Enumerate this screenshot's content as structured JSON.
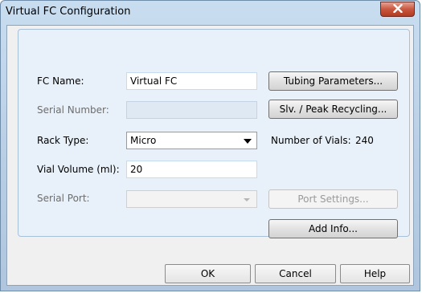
{
  "window": {
    "title": "Virtual FC Configuration"
  },
  "form": {
    "fc_name": {
      "label": "FC Name:",
      "value": "Virtual FC"
    },
    "serial_number": {
      "label": "Serial Number:",
      "value": ""
    },
    "rack_type": {
      "label": "Rack Type:",
      "value": "Micro"
    },
    "vial_volume": {
      "label": "Vial Volume (ml):",
      "value": "20"
    },
    "serial_port": {
      "label": "Serial Port:",
      "value": ""
    },
    "number_of_vials": {
      "label": "Number of Vials:",
      "value": "240"
    }
  },
  "buttons": {
    "tubing_parameters": "Tubing Parameters...",
    "slv_peak_recycling": "Slv. / Peak Recycling...",
    "port_settings": "Port Settings...",
    "add_info": "Add Info...",
    "ok": "OK",
    "cancel": "Cancel",
    "help": "Help"
  },
  "icons": {
    "close": "close-icon",
    "dropdown": "chevron-down-icon"
  }
}
